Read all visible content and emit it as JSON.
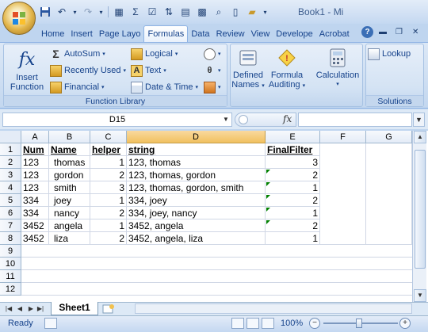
{
  "window": {
    "title": "Book1 - Mi"
  },
  "quick_access": [
    "save-icon",
    "undo-icon",
    "redo-icon",
    "print-icon"
  ],
  "tabs": [
    "Home",
    "Insert",
    "Page Layo",
    "Formulas",
    "Data",
    "Review",
    "View",
    "Develope",
    "Acrobat"
  ],
  "active_tab": "Formulas",
  "ribbon": {
    "insert_function": {
      "icon": "fx",
      "line1": "Insert",
      "line2": "Function"
    },
    "function_library": {
      "caption": "Function Library",
      "autosum": "AutoSum",
      "recently_used": "Recently Used",
      "financial": "Financial",
      "logical": "Logical",
      "text": "Text",
      "date_time": "Date & Time"
    },
    "defined_names": {
      "line1": "Defined",
      "line2": "Names"
    },
    "formula_auditing": {
      "line1": "Formula",
      "line2": "Auditing"
    },
    "calculation": {
      "label": "Calculation"
    },
    "solutions": {
      "caption": "Solutions",
      "lookup": "Lookup"
    }
  },
  "formula_bar": {
    "name_box": "D15",
    "fx": "fx",
    "value": ""
  },
  "columns": [
    "A",
    "B",
    "C",
    "D",
    "E",
    "F",
    "G"
  ],
  "rows": [
    "1",
    "2",
    "3",
    "4",
    "5",
    "6",
    "7",
    "8",
    "9",
    "10",
    "11",
    "12"
  ],
  "cells": {
    "r1": {
      "a": "Num",
      "b": "Name",
      "c": "helper",
      "d": "string",
      "e": "FinalFilter"
    },
    "r2": {
      "a": "123",
      "b": "thomas",
      "c": "1",
      "d": "123,  thomas",
      "e": "3"
    },
    "r3": {
      "a": "123",
      "b": "gordon",
      "c": "2",
      "d": "123,  thomas,  gordon",
      "e": "2"
    },
    "r4": {
      "a": "123",
      "b": "smith",
      "c": "3",
      "d": "123,  thomas,  gordon,  smith",
      "e": "1"
    },
    "r5": {
      "a": "334",
      "b": "joey",
      "c": "1",
      "d": "334,  joey",
      "e": "2"
    },
    "r6": {
      "a": "334",
      "b": "nancy",
      "c": "2",
      "d": "334,  joey,  nancy",
      "e": "1"
    },
    "r7": {
      "a": "3452",
      "b": "angela",
      "c": "1",
      "d": "3452,  angela",
      "e": "2"
    },
    "r8": {
      "a": "3452",
      "b": "liza",
      "c": "2",
      "d": "3452,  angela,  liza",
      "e": "1"
    }
  },
  "sheet_tabs": [
    "Sheet1"
  ],
  "status": {
    "ready": "Ready",
    "zoom": "100%",
    "zoom_percent": 100
  },
  "colors": {
    "selected_column": "#f1c15f",
    "error_triangle": "#008000",
    "ribbon": "#c3d7ef"
  }
}
